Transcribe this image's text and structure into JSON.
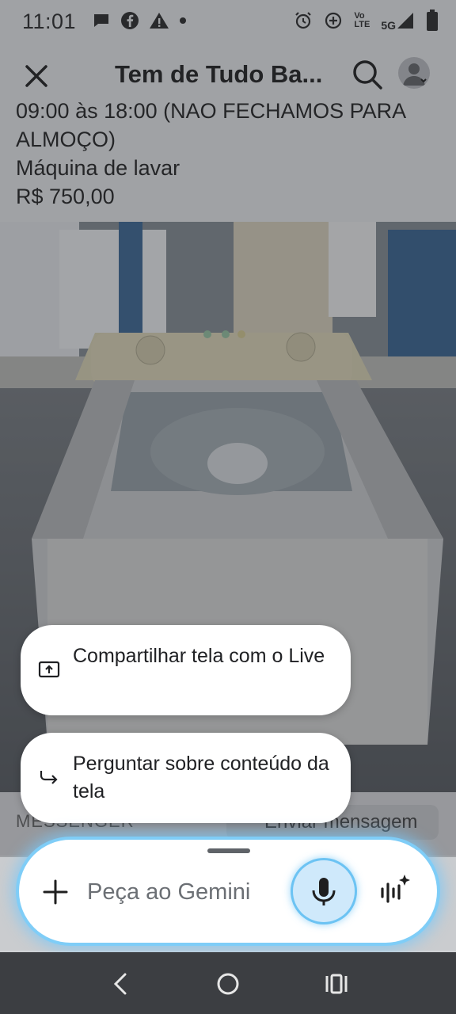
{
  "status_bar": {
    "time": "11:01",
    "signal_label": "5G",
    "volte_label": "Vo\nLTE"
  },
  "app_bar": {
    "title": "Tem de Tudo Ba..."
  },
  "listing": {
    "hours": "09:00 às 18:00 (NAO FECHAMOS PARA ALMOÇO)",
    "item_name": "Máquina de lavar",
    "price": "R$ 750,00"
  },
  "messenger": {
    "label": "MESSENGER",
    "send_button": "Enviar mensagem"
  },
  "suggestions": [
    {
      "label": "Compartilhar tela com o Live",
      "icon": "screen-share-icon"
    },
    {
      "label": "Perguntar sobre conteúdo da tela",
      "icon": "reply-arrow-icon"
    }
  ],
  "gemini": {
    "placeholder": "Peça ao Gemini"
  },
  "colors": {
    "glow": "#7fcdf7",
    "mic_fill": "#cfe9fb"
  }
}
